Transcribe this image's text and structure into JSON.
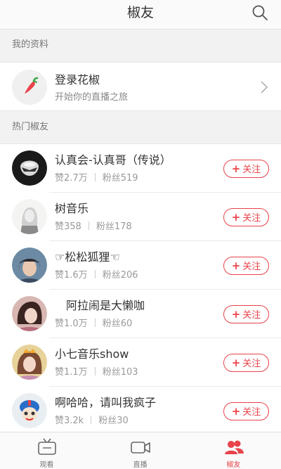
{
  "header": {
    "title": "椒友"
  },
  "sections": {
    "profile": "我的资料",
    "hot": "热门椒友"
  },
  "profile": {
    "name": "登录花椒",
    "subtitle": "开始你的直播之旅"
  },
  "follow_label": "关注",
  "users": [
    {
      "name": "认真会-认真哥（传说）",
      "likes": "赞2.7万",
      "fans": "粉丝519"
    },
    {
      "name": "树音乐",
      "likes": "赞358",
      "fans": "粉丝178"
    },
    {
      "name": "☞松松狐狸☜",
      "likes": "赞1.6万",
      "fans": "粉丝206"
    },
    {
      "name": "　阿拉闹是大懒咖",
      "likes": "赞1.0万",
      "fans": "粉丝60"
    },
    {
      "name": "小七音乐show",
      "likes": "赞1.1万",
      "fans": "粉丝103"
    },
    {
      "name": "啊哈哈，请叫我疯子",
      "likes": "赞3.2k",
      "fans": "粉丝30"
    }
  ],
  "tabs": [
    {
      "label": "观看",
      "icon": "tv-icon"
    },
    {
      "label": "直播",
      "icon": "camera-icon"
    },
    {
      "label": "椒友",
      "icon": "friends-icon"
    }
  ],
  "colors": {
    "accent": "#e8434b"
  }
}
